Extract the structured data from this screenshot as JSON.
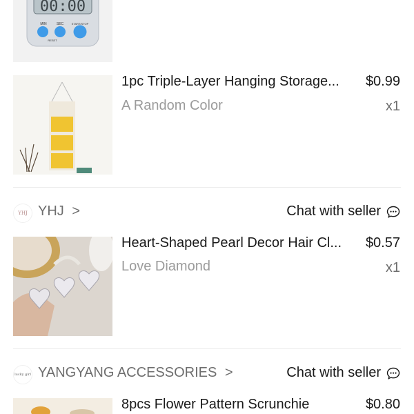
{
  "items": [
    {
      "title": "1pc Triple-Layer Hanging Storage...",
      "price": "$0.99",
      "variant": "A Random Color",
      "qty": "x1"
    },
    {
      "title": "Heart-Shaped Pearl Decor Hair Cl...",
      "price": "$0.57",
      "variant": "Love Diamond",
      "qty": "x1"
    },
    {
      "title": "8pcs Flower Pattern Scrunchie",
      "price": "$0.80"
    }
  ],
  "stores": [
    {
      "name": "YHJ",
      "chevron": ">",
      "chat_label": "Chat with seller",
      "logo_text": "YHJ"
    },
    {
      "name": "YANGYANG ACCESSORIES",
      "chevron": ">",
      "chat_label": "Chat with seller",
      "logo_text": "lucky girl"
    }
  ],
  "timer_image": {
    "buttons": [
      "MIN",
      "SEC",
      "START/STOP"
    ],
    "reset_label": "RESET",
    "display": "00:00"
  },
  "icons": {
    "chat": "chat-bubble-icon",
    "chevron": "chevron-right-icon"
  },
  "colors": {
    "text": "#1a1a1a",
    "muted": "#9b9b9b",
    "divider": "#ececec",
    "timer_button": "#3f9be8",
    "storage_yellow": "#f0c431"
  }
}
